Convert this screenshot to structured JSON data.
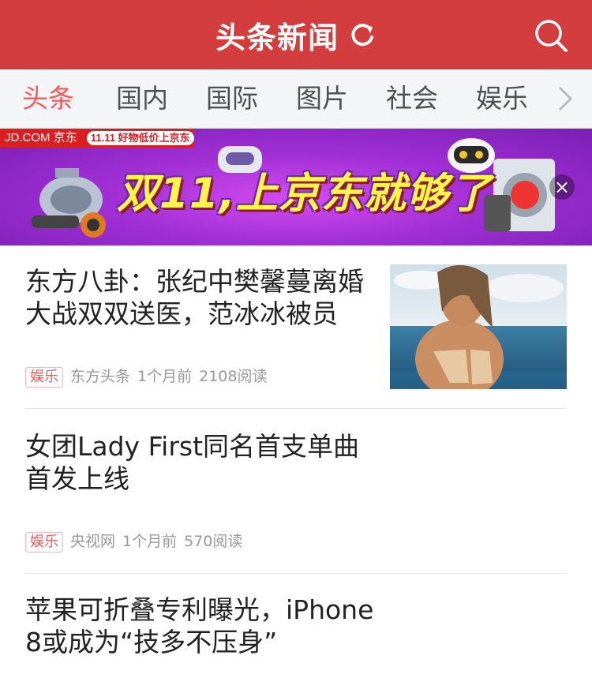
{
  "header": {
    "title": "头条新闻",
    "refresh_icon": "refresh-icon",
    "search_icon": "search-icon",
    "bg": "#d43d3d"
  },
  "tabs": [
    {
      "label": "头条",
      "active": true
    },
    {
      "label": "国内"
    },
    {
      "label": "国际"
    },
    {
      "label": "图片"
    },
    {
      "label": "社会"
    },
    {
      "label": "娱乐"
    }
  ],
  "ad": {
    "brand": "JD.COM 京东",
    "tag": "11.11 好物低价上京东",
    "slogan": "双11,上京东就够了",
    "close": "×"
  },
  "articles": [
    {
      "title": "东方八卦：张纪中樊馨蔓离婚大战双双送医，范冰冰被员",
      "category": "娱乐",
      "source": "东方头条",
      "time": "1个月前",
      "reads": "2108阅读",
      "has_image": true
    },
    {
      "title": "女团Lady First同名首支单曲首发上线",
      "category": "娱乐",
      "source": "央视网",
      "time": "1个月前",
      "reads": "570阅读"
    },
    {
      "title": "苹果可折叠专利曝光，iPhone 8或成为“技多不压身”"
    }
  ]
}
